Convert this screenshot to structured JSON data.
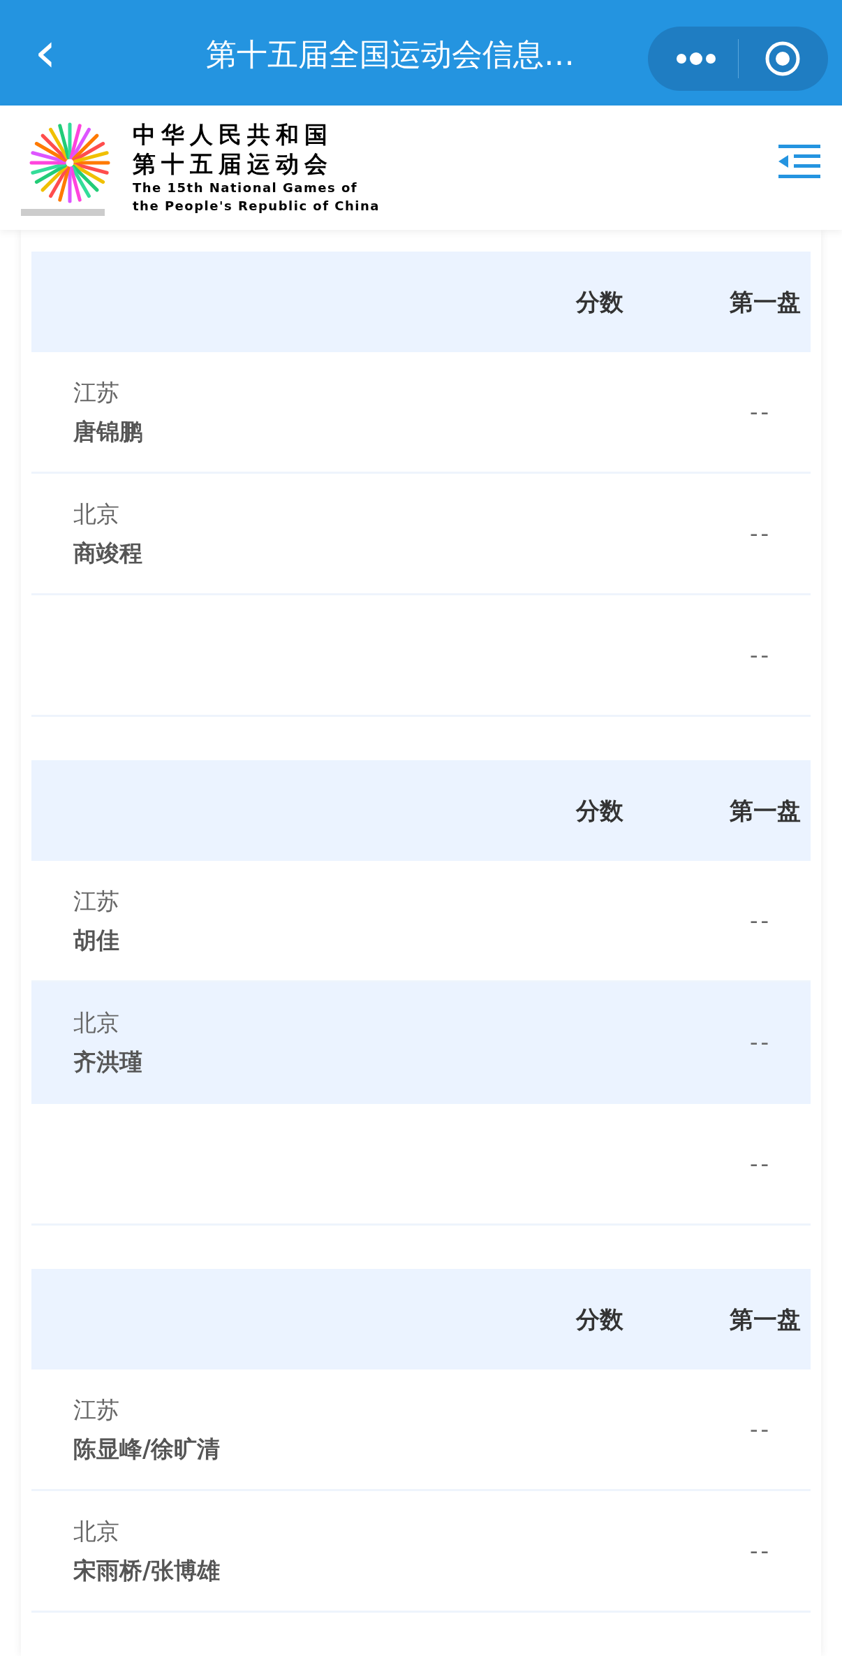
{
  "nav_bar": {
    "back": "‹",
    "title": "第十五届全国运动会信息…"
  },
  "site_header": {
    "logo_lines": [
      "中华人民共和国",
      "第十五届运动会",
      "The 15th National Games of",
      "the People's Republic of China"
    ]
  },
  "matches": [
    {
      "columns": [
        "分数",
        "第一盘"
      ],
      "rows": [
        {
          "team": "江苏",
          "player": "唐锦鹏",
          "set_1": "--",
          "selected": false
        },
        {
          "team": "北京",
          "player": "商竣程",
          "set_1": "--",
          "selected": false
        },
        {
          "set_1": "--",
          "selected": false
        }
      ]
    },
    {
      "columns": [
        "分数",
        "第一盘"
      ],
      "rows": [
        {
          "team": "江苏",
          "player": "胡佳",
          "set_1": "--",
          "selected": false
        },
        {
          "team": "北京",
          "player": "齐洪瑾",
          "set_1": "--",
          "selected": true
        },
        {
          "set_1": "--",
          "selected": false
        }
      ]
    },
    {
      "columns": [
        "分数",
        "第一盘"
      ],
      "rows": [
        {
          "team": "江苏",
          "player": "陈显峰/徐旷清",
          "set_1": "--",
          "selected": false
        },
        {
          "team": "北京",
          "player": "宋雨桥/张博雄",
          "set_1": "--",
          "selected": false
        }
      ]
    }
  ]
}
